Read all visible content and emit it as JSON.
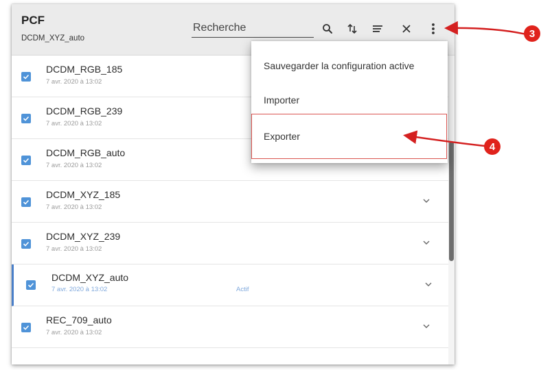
{
  "header": {
    "title": "PCF",
    "subtitle": "DCDM_XYZ_auto"
  },
  "search": {
    "placeholder": "Recherche"
  },
  "toolbar": {
    "icons": [
      "search-icon",
      "sort-icon",
      "filter-icon",
      "close-icon",
      "more-vertical-icon"
    ]
  },
  "rows": [
    {
      "name": "DCDM_RGB_185",
      "date": "7 avr. 2020 à 13:02"
    },
    {
      "name": "DCDM_RGB_239",
      "date": "7 avr. 2020 à 13:02"
    },
    {
      "name": "DCDM_RGB_auto",
      "date": "7 avr. 2020 à 13:02"
    },
    {
      "name": "DCDM_XYZ_185",
      "date": "7 avr. 2020 à 13:02"
    },
    {
      "name": "DCDM_XYZ_239",
      "date": "7 avr. 2020 à 13:02"
    },
    {
      "name": "DCDM_XYZ_auto",
      "date": "7 avr. 2020 à 13:02",
      "status": "Actif"
    },
    {
      "name": "REC_709_auto",
      "date": "7 avr. 2020 à 13:02"
    }
  ],
  "menu": {
    "items": [
      {
        "label": "Sauvegarder la configuration active"
      },
      {
        "label": "Importer"
      },
      {
        "label": "Exporter"
      }
    ]
  },
  "callouts": {
    "menu_button": "3",
    "export_item": "4"
  },
  "colors": {
    "accent": "#4f93d8",
    "active_border": "#4a7fc9",
    "callout": "#e0231c",
    "header_bg": "#ebebeb"
  }
}
